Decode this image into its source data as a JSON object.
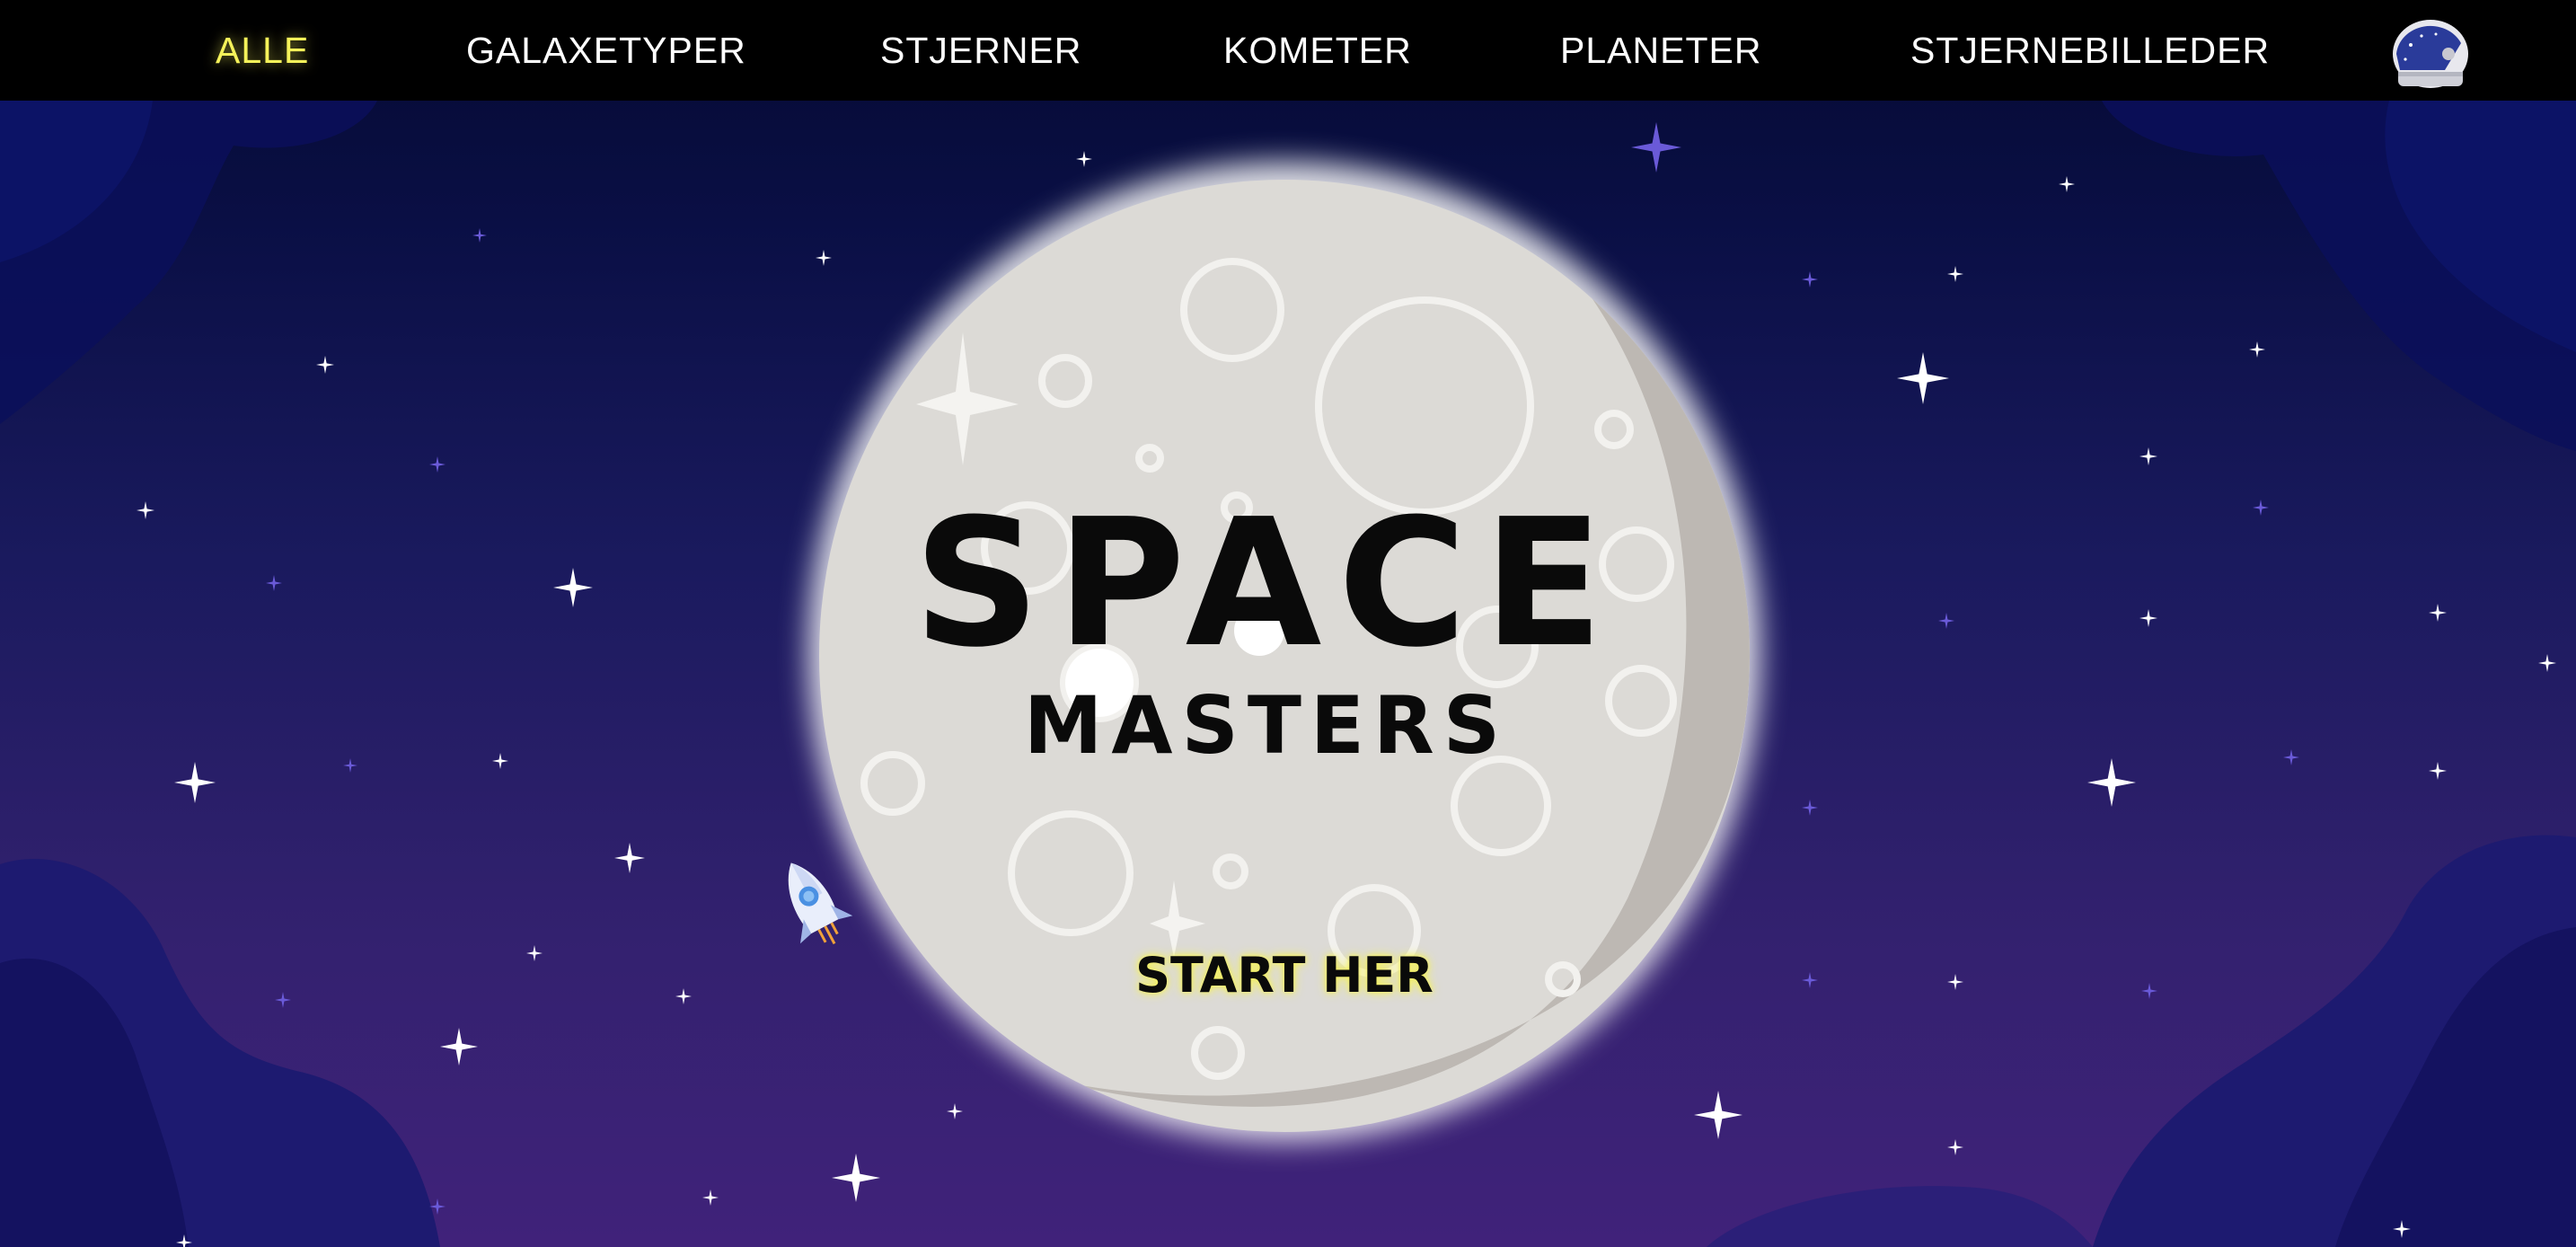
{
  "nav": {
    "items": [
      {
        "label": "ALLE",
        "active": true
      },
      {
        "label": "GALAXETYPER",
        "active": false
      },
      {
        "label": "STJERNER",
        "active": false
      },
      {
        "label": "KOMETER",
        "active": false
      },
      {
        "label": "PLANETER",
        "active": false
      },
      {
        "label": "STJERNEBILLEDER",
        "active": false
      }
    ],
    "profile_icon": "astronaut-helmet-icon"
  },
  "hero": {
    "title": "SPACE",
    "subtitle": "MASTERS",
    "cta_label": "START HER"
  },
  "decor": {
    "moon_icon": "moon-icon",
    "rocket_icon": "rocket-icon",
    "star_icon": "sparkle-star-icon"
  },
  "colors": {
    "nav_background": "#000000",
    "nav_text": "#ffffff",
    "nav_active": "#f5f25a",
    "sky_top": "#050a33",
    "sky_bottom": "#40227a",
    "moon": "#dcdad6",
    "moon_shadow": "#bdb8b3",
    "title_text": "#0a0a0a",
    "cta_glow": "#f5f25a"
  }
}
